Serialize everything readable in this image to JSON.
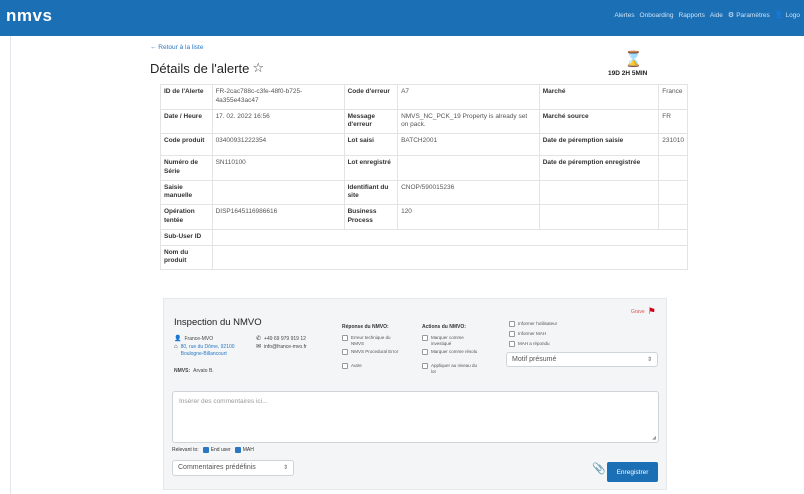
{
  "navbar": {
    "brand": "nmvs",
    "links": [
      "Alertes",
      "Onboarding",
      "Rapports",
      "Aide"
    ],
    "settings_label": "Paramètres",
    "logout_label": "Logo"
  },
  "header": {
    "back_link": "← Retour à la liste",
    "title": "Détails de l'alerte",
    "timer": "19D 2H 5MIN"
  },
  "details": {
    "rows": [
      [
        {
          "label": "ID de l'Alerte",
          "value": "FR-2cac788c-c3fe-48f0-b725-4a355e43ac47"
        },
        {
          "label": "Code d'erreur",
          "value": "A7"
        },
        {
          "label": "Marché",
          "value": "France"
        }
      ],
      [
        {
          "label": "Date / Heure",
          "value": "17. 02. 2022 16:56"
        },
        {
          "label": "Message d'erreur",
          "value": "NMVS_NC_PCK_19 Property is already set on pack."
        },
        {
          "label": "Marché source",
          "value": "FR"
        }
      ],
      [
        {
          "label": "Code produit",
          "value": "03400931222354"
        },
        {
          "label": "Lot saisi",
          "value": "BATCH2001"
        },
        {
          "label": "Date de péremption saisie",
          "value": "231010"
        }
      ],
      [
        {
          "label": "Numéro de Série",
          "value": "SN110100"
        },
        {
          "label": "Lot enregistré",
          "value": ""
        },
        {
          "label": "Date de péremption enregistrée",
          "value": ""
        }
      ],
      [
        {
          "label": "Saisie manuelle",
          "value": ""
        },
        {
          "label": "Identifiant du site",
          "value": "CNOP/590015236"
        },
        {
          "label": "",
          "value": ""
        }
      ],
      [
        {
          "label": "Opération tentée",
          "value": "DISP1645116986616"
        },
        {
          "label": "Business Process",
          "value": "120"
        },
        {
          "label": "",
          "value": ""
        }
      ]
    ],
    "sub_user_label": "Sub-User ID",
    "product_name_label": "Nom du produit"
  },
  "inspection": {
    "title": "Inspection du NMVO",
    "org": "France-MVO",
    "address": "80, rue du Dôme, 92100 Boulogne-Billancourt",
    "nmvs_label": "NMVS:",
    "nmvs_user": "Arvato B.",
    "phone": "+49 69 979 919 12",
    "email": "info@france-mvo.fr",
    "response_head": "Réponse du NMVO:",
    "responses": [
      "Erreur technique du NMVS",
      "NMVS Procedural Error",
      "Autre"
    ],
    "actions_head": "Actions du NMVO:",
    "actions": [
      "Marquer comme investiqué",
      "Marquer comme résolu",
      "Appliquer au niveau du lot"
    ],
    "notify": [
      "Informer l'utilisateur",
      "Informer MAH",
      "MAH a répondu"
    ],
    "motif_select": "Motif présumé",
    "gravite": "Grave",
    "comment_placeholder": "Insérer des commentaires ici...",
    "relevant_label": "Relevant to:",
    "relevant_end_user": "End user",
    "relevant_mah": "MAH",
    "predefined_select": "Commentaires prédéfinis",
    "save_label": "Enregistrer"
  },
  "colors": {
    "navbar": "#1b6fb5",
    "link": "#2a78c4",
    "flag": "#d0021b"
  }
}
